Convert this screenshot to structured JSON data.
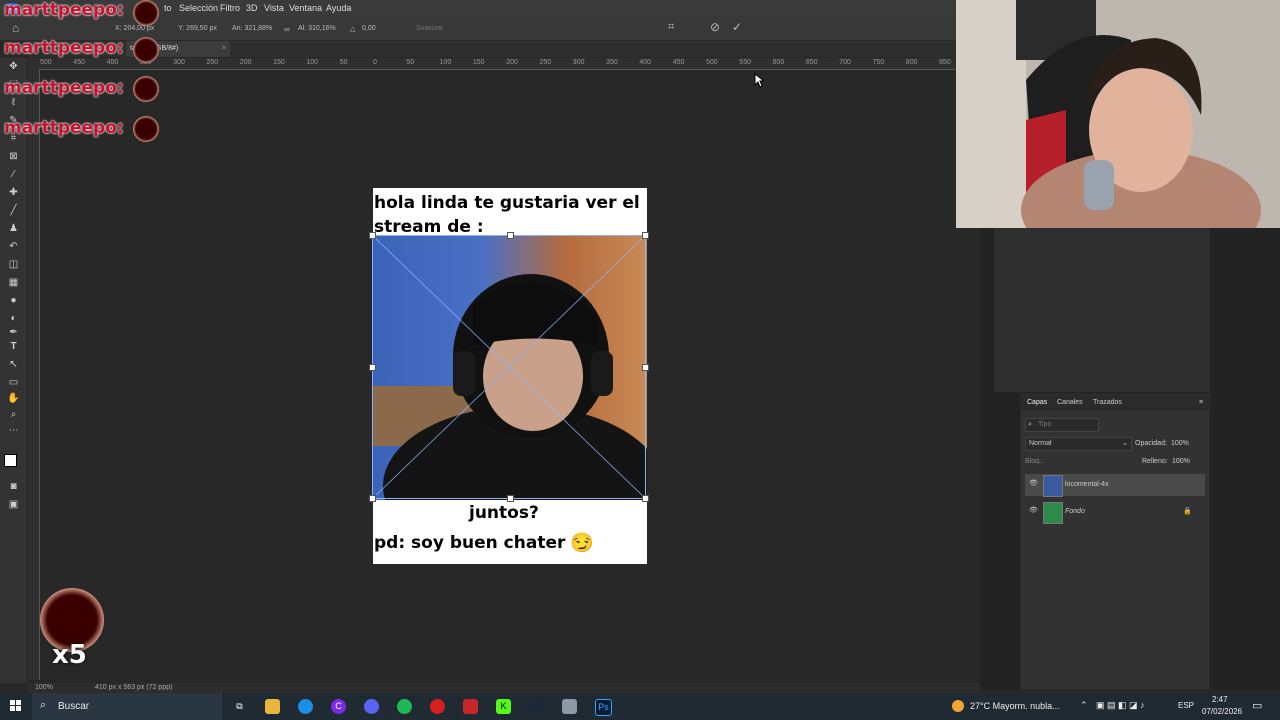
{
  "menu": {
    "items": [
      "Selección",
      "Filtro",
      "3D",
      "Vista",
      "Ventana",
      "Ayuda"
    ],
    "partial": "to"
  },
  "options": {
    "x": "X: 204,00 px",
    "y": "Y: 269,50 px",
    "w": "An: 321,88%",
    "h": "Al: 310,16%",
    "angle": "0,00",
    "interp": "Suavizar"
  },
  "document": {
    "tab_label": "tal-4x, RGB/8#)",
    "top_text": "hola linda te gustaria ver el stream de :",
    "mid_text": "juntos?",
    "bottom_text": "pd: soy buen chater",
    "emoji": "😏"
  },
  "ruler_ticks": [
    "500",
    "450",
    "400",
    "350",
    "300",
    "250",
    "200",
    "150",
    "100",
    "50",
    "0",
    "50",
    "100",
    "150",
    "200",
    "250",
    "300",
    "350",
    "400",
    "450",
    "500",
    "550",
    "600",
    "650",
    "700",
    "750",
    "800",
    "850"
  ],
  "status": {
    "zoom": "100%",
    "size": "410 px x 563 px (72 ppp)"
  },
  "layers_panel": {
    "tabs": [
      "Capas",
      "Canales",
      "Trazados"
    ],
    "search_placeholder": "Tipo",
    "blend_mode": "Normal",
    "opacity_label": "Opacidad:",
    "opacity_value": "100%",
    "fill_label": "Relleno:",
    "fill_value": "100%",
    "lock_label": "Bloq.:",
    "layers": [
      {
        "name": "locomental-4x",
        "italic": false
      },
      {
        "name": "Fondo",
        "italic": true
      }
    ]
  },
  "chat": {
    "username": "marttpeepo:",
    "combo_count": "x5"
  },
  "taskbar": {
    "search_label": "Buscar",
    "weather": "27°C Mayorm. nubla...",
    "lang": "ESP",
    "time": "2:47",
    "date": "07/02/2026"
  },
  "colors": {
    "chat_red": "#c8102e",
    "selection_blue": "#8ab4ff"
  }
}
